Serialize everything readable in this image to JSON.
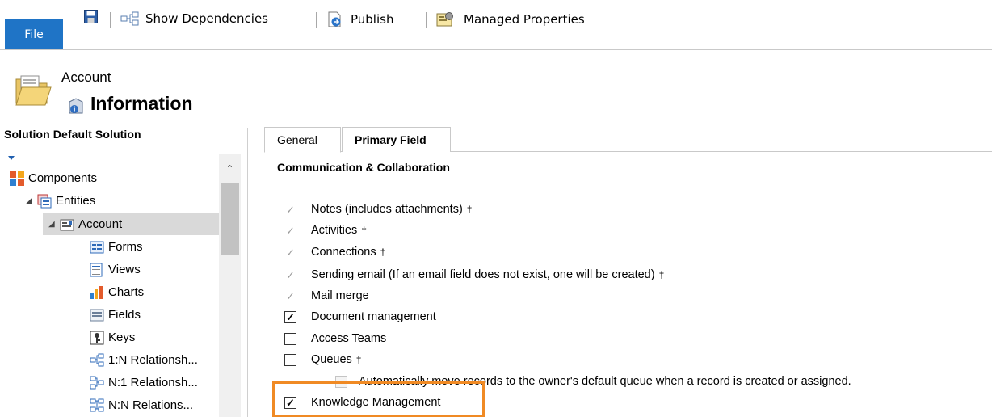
{
  "ribbon": {
    "file_label": "File",
    "save_icon": "save-icon",
    "show_dependencies_label": "Show Dependencies",
    "publish_label": "Publish",
    "managed_properties_label": "Managed Properties"
  },
  "header": {
    "entity_name": "Account",
    "page_title": "Information"
  },
  "nav": {
    "solution_label": "Solution Default Solution",
    "items": [
      {
        "label": "Components",
        "icon": "components-icon"
      },
      {
        "label": "Entities",
        "icon": "entities-icon"
      },
      {
        "label": "Account",
        "icon": "account-icon"
      },
      {
        "label": "Forms",
        "icon": "forms-icon"
      },
      {
        "label": "Views",
        "icon": "views-icon"
      },
      {
        "label": "Charts",
        "icon": "charts-icon"
      },
      {
        "label": "Fields",
        "icon": "fields-icon"
      },
      {
        "label": "Keys",
        "icon": "keys-icon"
      },
      {
        "label": "1:N Relationsh...",
        "icon": "relationship-1n-icon"
      },
      {
        "label": "N:1 Relationsh...",
        "icon": "relationship-n1-icon"
      },
      {
        "label": "N:N Relations...",
        "icon": "relationship-nn-icon"
      }
    ]
  },
  "tabs": [
    {
      "label": "General",
      "selected": true
    },
    {
      "label": "Primary Field",
      "selected": false
    }
  ],
  "section": {
    "title": "Communication & Collaboration",
    "options": [
      {
        "label": "Notes (includes attachments)",
        "dagger": "†",
        "state": "checked-disabled"
      },
      {
        "label": "Activities",
        "dagger": "†",
        "state": "checked-disabled"
      },
      {
        "label": "Connections",
        "dagger": "†",
        "state": "checked-disabled"
      },
      {
        "label": "Sending email (If an email field does not exist, one will be created)",
        "dagger": "†",
        "state": "checked-disabled"
      },
      {
        "label": "Mail merge",
        "dagger": "",
        "state": "checked-disabled"
      },
      {
        "label": "Document management",
        "dagger": "",
        "state": "checked"
      },
      {
        "label": "Access Teams",
        "dagger": "",
        "state": "unchecked"
      },
      {
        "label": "Queues",
        "dagger": "†",
        "state": "unchecked"
      },
      {
        "label": "Automatically move records to the owner's default queue when a record is created or assigned.",
        "dagger": "",
        "state": "unchecked-disabled"
      },
      {
        "label": "Knowledge Management",
        "dagger": "",
        "state": "checked"
      }
    ]
  },
  "colors": {
    "file_button": "#1f74c6",
    "highlight": "#f08a24"
  }
}
